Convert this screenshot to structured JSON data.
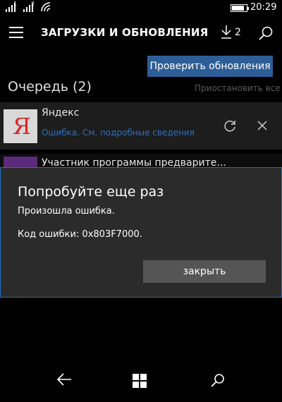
{
  "status_bar": {
    "sim1": "1",
    "sim2": "2",
    "time": "20:29",
    "battery_level": 0.85
  },
  "header": {
    "title": "ЗАГРУЗКИ И ОБНОВЛЕНИЯ",
    "download_count": "2"
  },
  "actions": {
    "check_updates": "Проверить обновления",
    "pause_all": "Приостановить все"
  },
  "queue": {
    "title": "Очередь (2)",
    "items": [
      {
        "name": "Яндекс",
        "status": "Ошибка. См. подробные сведения",
        "logo_letter": "Я"
      },
      {
        "name": "Участник программы предварите..."
      }
    ]
  },
  "dialog": {
    "title": "Попробуйте еще раз",
    "message": "Произошла ошибка.",
    "code": "Код ошибки: 0x803F7000.",
    "close_label": "закрыть"
  },
  "colors": {
    "accent": "#2d5e97",
    "dialog_border": "#1f6fc5",
    "error_link": "#2e6fbd"
  }
}
